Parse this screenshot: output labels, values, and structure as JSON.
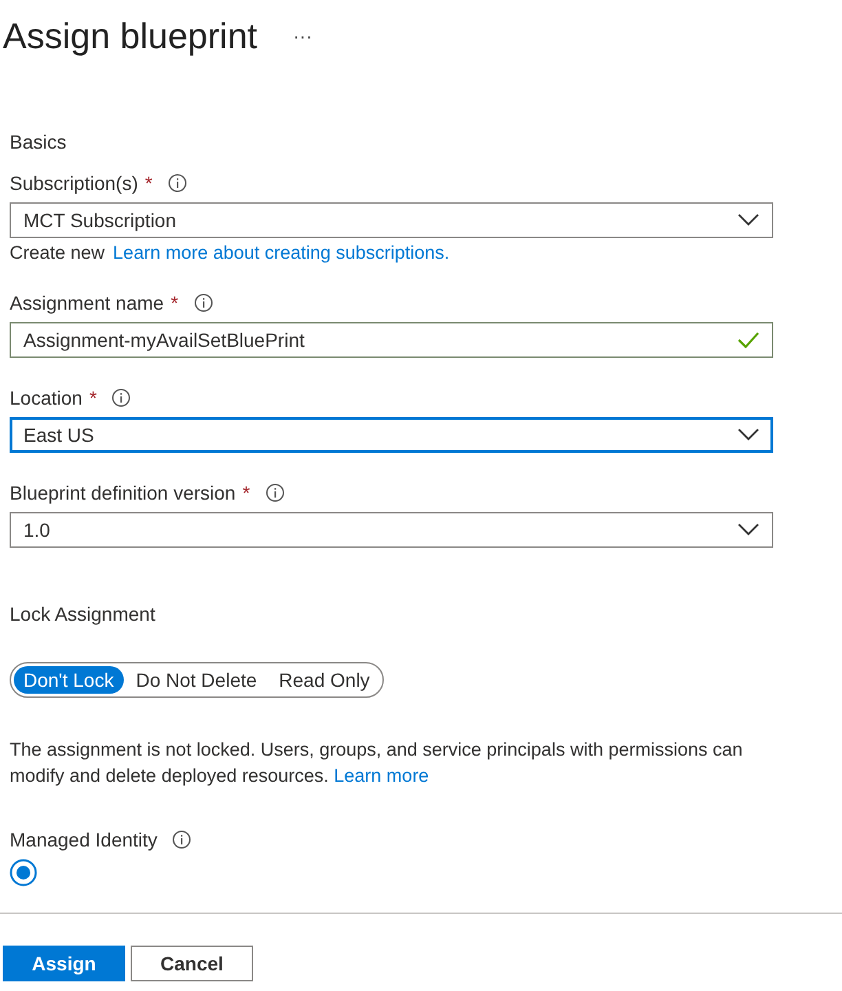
{
  "title": "Assign blueprint",
  "more_icon": "···",
  "section": "Basics",
  "fields": [
    {
      "kind": "dropdown",
      "label": "Subscription(s)",
      "required_mark": "*",
      "value": "MCT Subscription",
      "focused": false,
      "helper": {
        "text": "Create new",
        "link": "Learn more about creating subscriptions."
      }
    },
    {
      "kind": "text",
      "label": "Assignment name",
      "required_mark": "*",
      "value": "Assignment-myAvailSetBluePrint",
      "focused": false,
      "valid": true
    },
    {
      "kind": "dropdown",
      "label": "Location",
      "required_mark": "*",
      "value": "East US",
      "focused": true
    },
    {
      "kind": "dropdown",
      "label": "Blueprint definition version",
      "required_mark": "*",
      "value": "1.0",
      "focused": false
    }
  ],
  "lock": {
    "label": "Lock Assignment",
    "options": [
      {
        "label": "Don't Lock",
        "selected": true
      },
      {
        "label": "Do Not Delete",
        "selected": false
      },
      {
        "label": "Read Only",
        "selected": false
      }
    ],
    "description": "The assignment is not locked. Users, groups, and service principals with permissions can modify and delete deployed resources.",
    "link": "Learn more"
  },
  "managed_identity": {
    "label": "Managed Identity",
    "radio_selected": true
  },
  "buttons": [
    {
      "label": "Assign",
      "kind": "primary"
    },
    {
      "label": "Cancel",
      "kind": "secondary"
    }
  ]
}
